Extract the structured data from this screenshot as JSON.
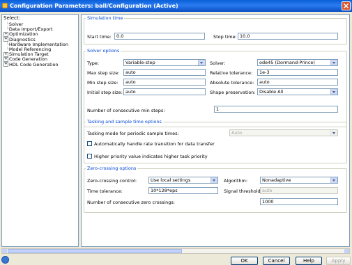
{
  "window": {
    "title": "Configuration Parameters: ball/Configuration (Active)"
  },
  "tree": {
    "header": "Select:",
    "items": [
      {
        "label": "Solver",
        "expander": ""
      },
      {
        "label": "Data Import/Export",
        "expander": ""
      },
      {
        "label": "Optimization",
        "expander": "+"
      },
      {
        "label": "Diagnostics",
        "expander": "+"
      },
      {
        "label": "Hardware Implementation",
        "expander": ""
      },
      {
        "label": "Model Referencing",
        "expander": ""
      },
      {
        "label": "Simulation Target",
        "expander": "+"
      },
      {
        "label": "Code Generation",
        "expander": "+"
      },
      {
        "label": "HDL Code Generation",
        "expander": "+"
      }
    ]
  },
  "sim_time": {
    "title": "Simulation time",
    "start_label": "Start time:",
    "start_value": "0.0",
    "stop_label": "Stop time:",
    "stop_value": "10.0"
  },
  "solver": {
    "title": "Solver options",
    "type_label": "Type:",
    "type_value": "Variable-step",
    "solver_label": "Solver:",
    "solver_value": "ode45 (Dormand-Prince)",
    "max_label": "Max step size:",
    "max_value": "auto",
    "reltol_label": "Relative tolerance:",
    "reltol_value": "1e-3",
    "min_label": "Min step size:",
    "min_value": "auto",
    "abstol_label": "Absolute tolerance:",
    "abstol_value": "auto",
    "init_label": "Initial step size:",
    "init_value": "auto",
    "shape_label": "Shape preservation:",
    "shape_value": "Disable All",
    "consec_label": "Number of consecutive min steps:",
    "consec_value": "1"
  },
  "tasking": {
    "title": "Tasking and sample time options",
    "periodic_label": "Tasking mode for periodic sample times:",
    "periodic_value": "Auto",
    "auto_rate_label": "Automatically handle rate transition for data transfer",
    "priority_label": "Higher priority value indicates higher task priority"
  },
  "zero_crossing": {
    "title": "Zero-crossing options",
    "control_label": "Zero-crossing control:",
    "control_value": "Use local settings",
    "algo_label": "Algorithm:",
    "algo_value": "Nonadaptive",
    "timetol_label": "Time tolerance:",
    "timetol_value": "10*128*eps",
    "threshold_label": "Signal threshold:",
    "threshold_value": "auto",
    "consec_label": "Number of consecutive zero crossings:",
    "consec_value": "1000"
  },
  "buttons": {
    "ok": "OK",
    "cancel": "Cancel",
    "help": "Help",
    "apply": "Apply"
  },
  "colors": {
    "titlebar": "#0a5fd8",
    "group_title": "#0046d5",
    "window_bg": "#ece9d8"
  }
}
